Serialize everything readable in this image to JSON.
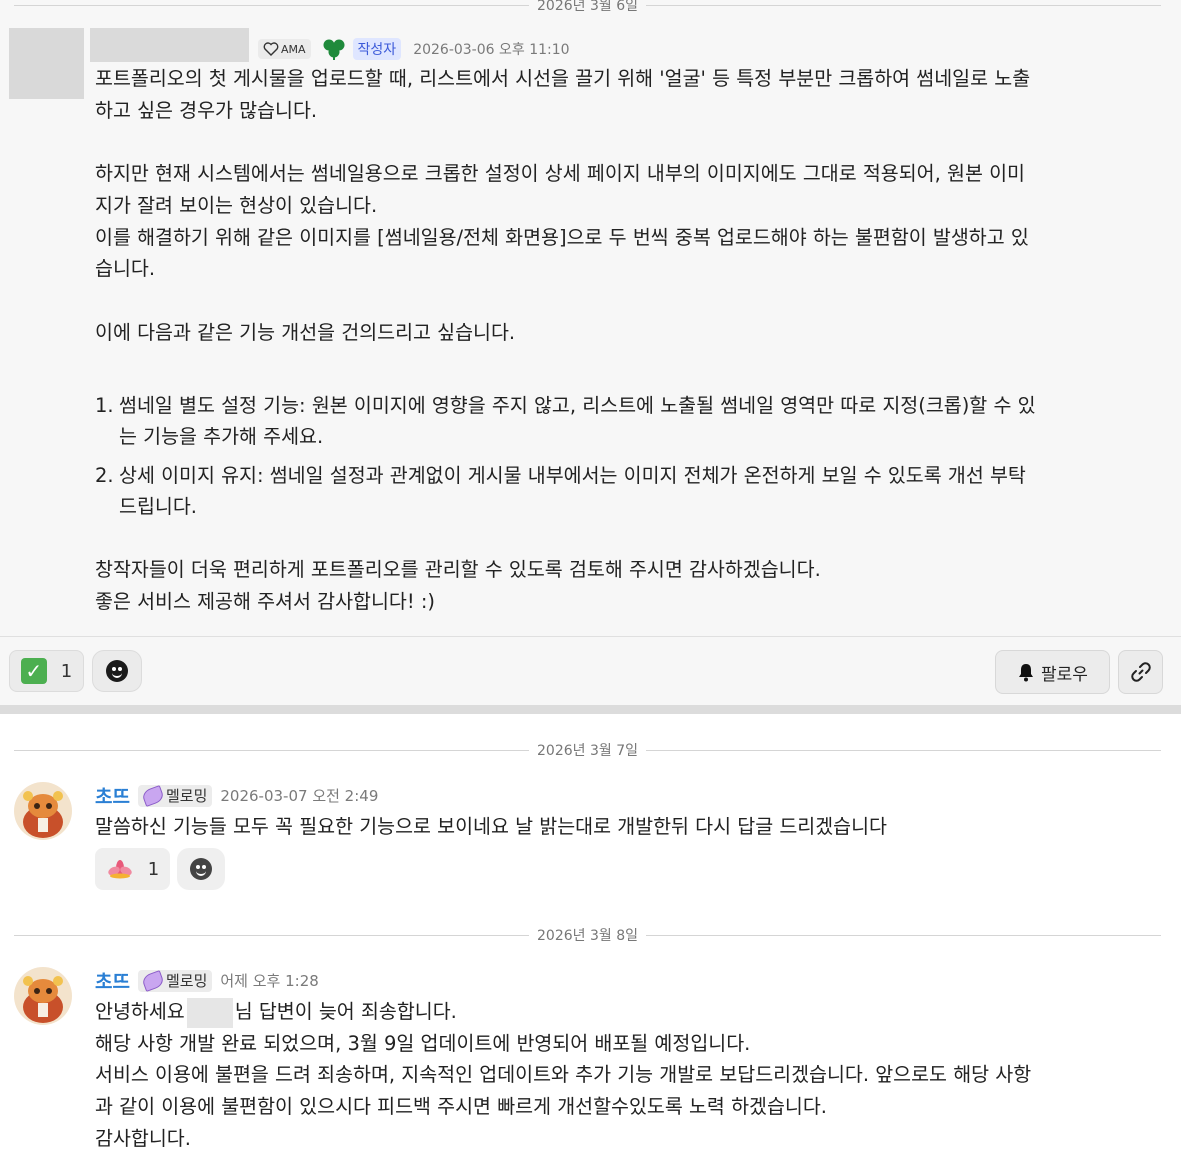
{
  "post": {
    "date_header": "2026년 3월 6일",
    "ama_badge": "AMA",
    "author_badge": "작성자",
    "timestamp": "2026-03-06 오후 11:10",
    "lines": [
      "포트폴리오의 첫 게시물을 업로드할 때, 리스트에서 시선을 끌기 위해 '얼굴' 등 특정 부분만 크롭하여 썸네일로 노출",
      "하고 싶은 경우가 많습니다.",
      "",
      "하지만 현재 시스템에서는 썸네일용으로 크롭한 설정이 상세 페이지 내부의 이미지에도 그대로 적용되어, 원본 이미",
      "지가 잘려 보이는 현상이 있습니다.",
      "이를 해결하기 위해 같은 이미지를 [썸네일용/전체 화면용]으로 두 번씩 중복 업로드해야 하는 불편함이 발생하고 있",
      "습니다.",
      "",
      "이에 다음과 같은 기능 개선을 건의드리고 싶습니다.",
      ""
    ],
    "list": [
      {
        "num": "1.",
        "line1": "썸네일 별도 설정 기능: 원본 이미지에 영향을 주지 않고, 리스트에 노출될 썸네일 영역만 따로 지정(크롭)할 수 있",
        "line2": "는 기능을 추가해 주세요."
      },
      {
        "num": "2.",
        "line1": "상세 이미지 유지: 썸네일 설정과 관계없이 게시물 내부에서는 이미지 전체가 온전하게 보일 수 있도록 개선 부탁",
        "line2": "드립니다."
      }
    ],
    "closing": [
      "창작자들이 더욱 편리하게 포트폴리오를 관리할 수 있도록 검토해 주시면 감사하겠습니다.",
      "좋은 서비스 제공해 주셔서 감사합니다! :)"
    ],
    "reaction_count": "1",
    "follow_label": "팔로우"
  },
  "reply1": {
    "date_header": "2026년 3월 7일",
    "username": "초뜨",
    "role": "멜로밍",
    "timestamp": "2026-03-07 오전 2:49",
    "text": "말씀하신 기능들 모두 꼭 필요한 기능으로 보이네요 날 밝는대로 개발한뒤 다시 답글 드리겠습니다",
    "reaction_count": "1"
  },
  "reply2": {
    "date_header": "2026년 3월 8일",
    "username": "초뜨",
    "role": "멜로밍",
    "timestamp": "어제 오후 1:28",
    "greeting_pre": "안녕하세요",
    "greeting_post": "님 답변이 늦어 죄송합니다.",
    "lines": [
      "해당 사항 개발 완료 되었으며, 3월 9일 업데이트에 반영되어 배포될 예정입니다.",
      "서비스 이용에 불편을 드려 죄송하며, 지속적인 업데이트와 추가 기능 개발로 보답드리겠습니다. 앞으로도 해당 사항",
      "과 같이 이용에 불편함이 있으시다 피드백 주시면 빠르게 개선할수있도록 노력 하겠습니다.",
      "감사합니다."
    ]
  },
  "icons": {
    "check": "check-mark-icon",
    "emoji": "add-emoji-icon",
    "lotus": "lotus-icon",
    "bell": "bell-icon",
    "link": "link-icon",
    "clover": "clover-icon",
    "heart": "heart-icon",
    "feather": "feather-icon"
  },
  "colors": {
    "username": "#2a7fd4",
    "author_badge_bg": "#dfe6ff",
    "author_badge_text": "#3d5bd9",
    "check_green": "#4caf50",
    "clover_green": "#1f8a3b"
  }
}
